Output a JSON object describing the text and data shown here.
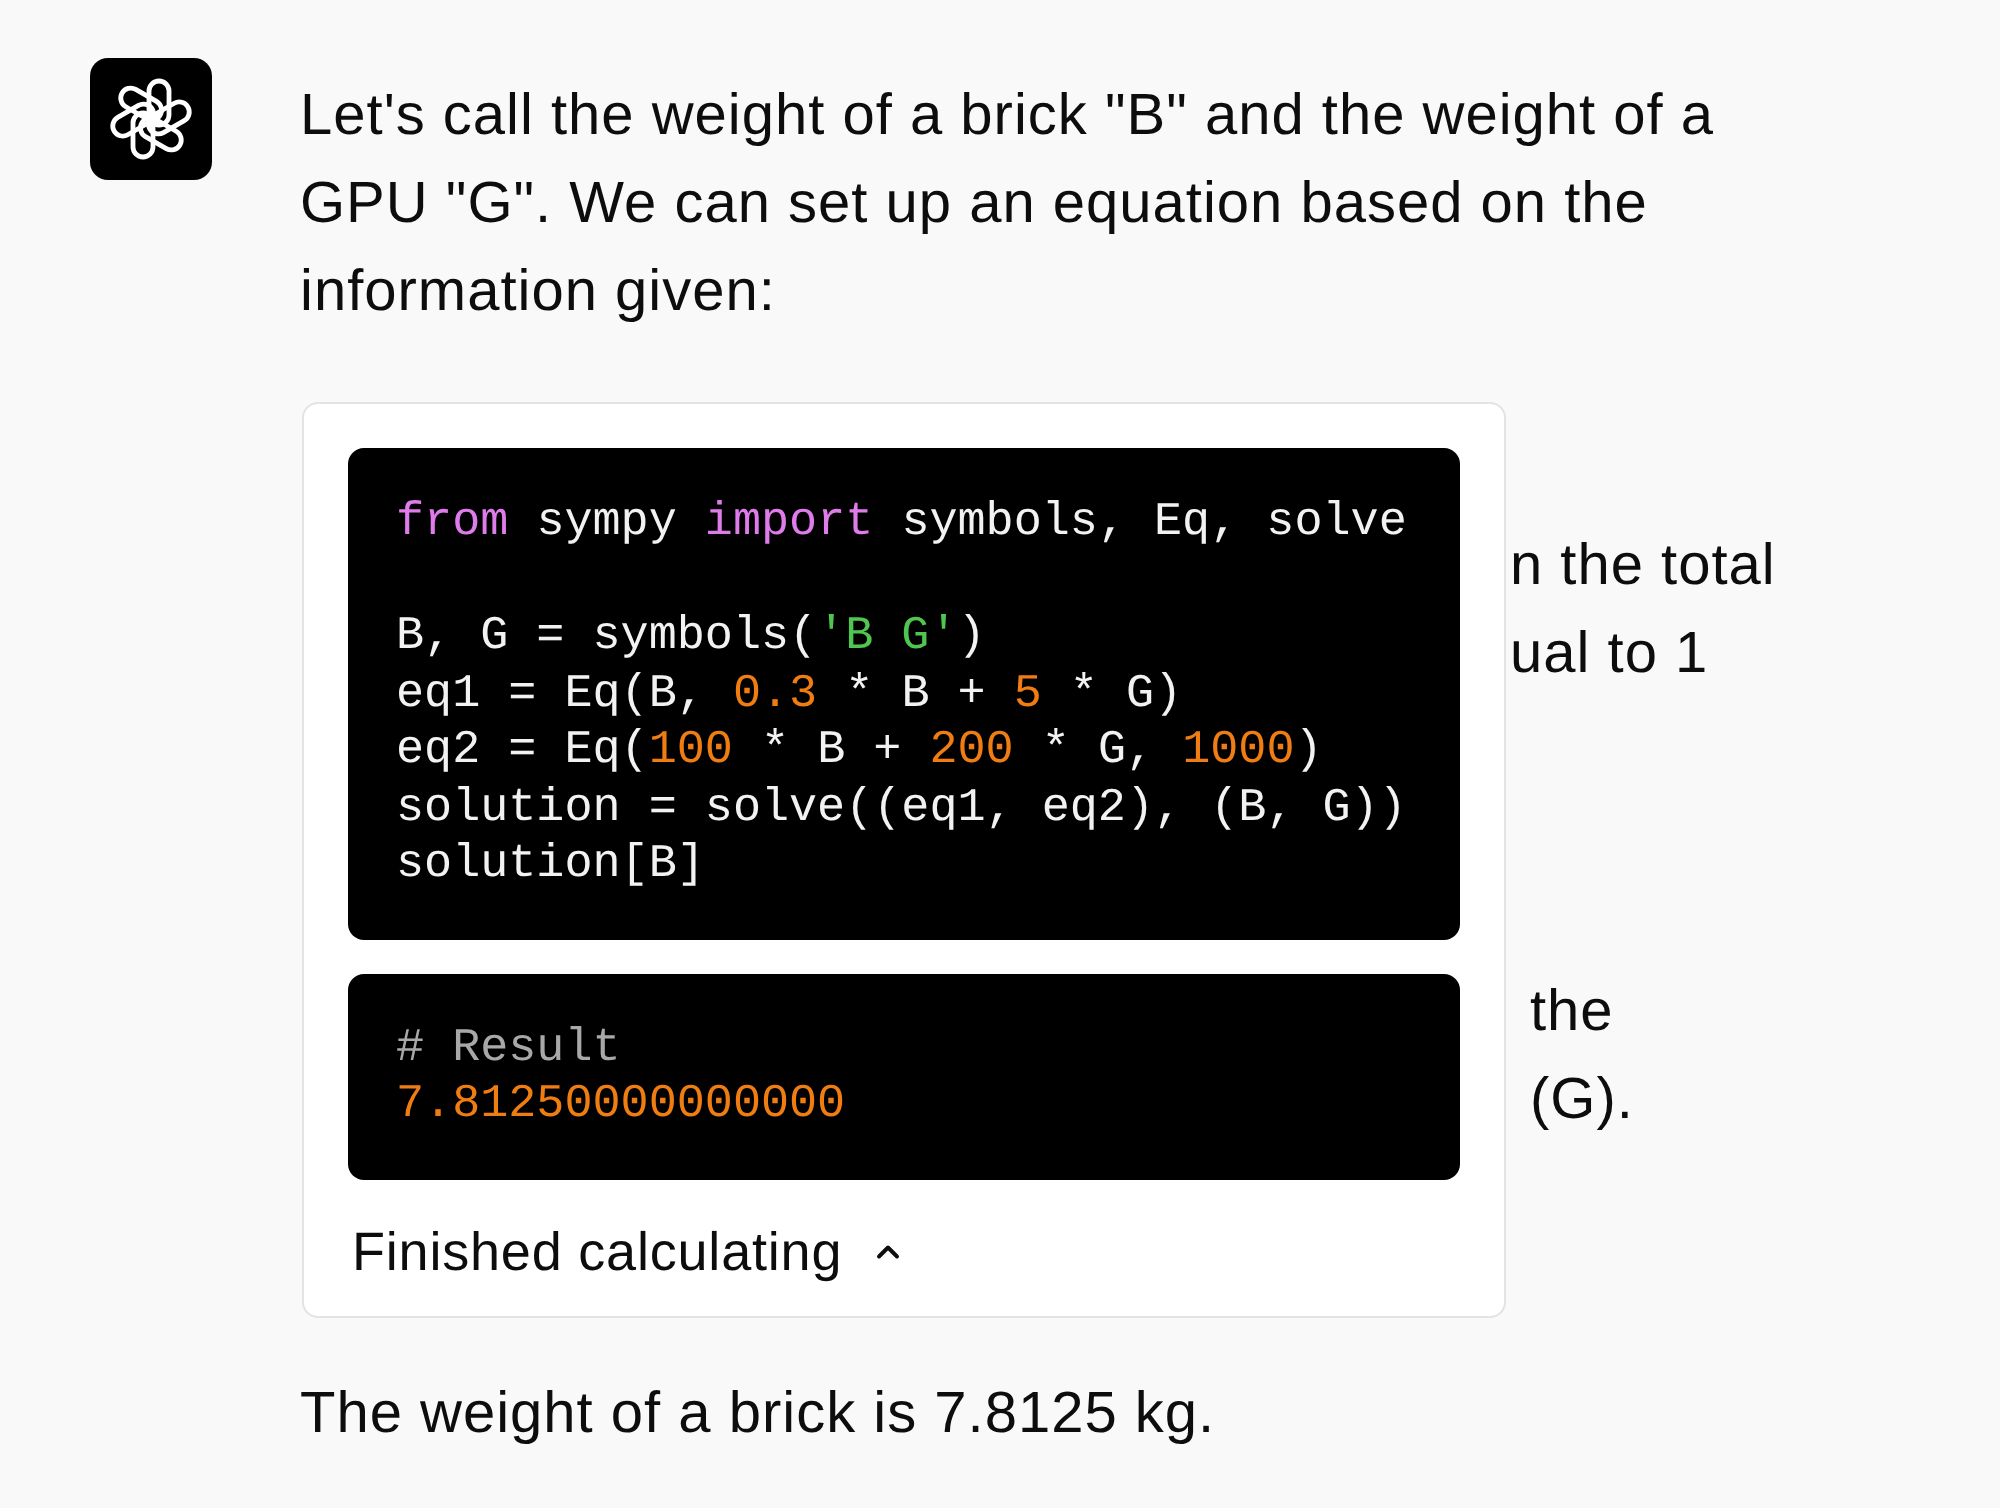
{
  "message": {
    "intro": "Let's call the weight of a brick \"B\" and the weight of a GPU \"G\". We can set up an equation based on the information given:",
    "covered_text": [
      [
        "n the total",
        "ual to 1"
      ],
      [
        "the",
        "(G)."
      ]
    ],
    "tool_card": {
      "code": {
        "blocks": [
          [
            [
              {
                "kind": "keyword",
                "text": "from"
              },
              {
                "kind": "plain",
                "text": " sympy "
              },
              {
                "kind": "keyword",
                "text": "import"
              },
              {
                "kind": "plain",
                "text": " symbols, Eq, solve"
              }
            ]
          ],
          [
            [
              {
                "kind": "plain",
                "text": "B, G = symbols("
              },
              {
                "kind": "string",
                "text": "'B G'"
              },
              {
                "kind": "plain",
                "text": ")"
              }
            ],
            [
              {
                "kind": "plain",
                "text": "eq1 = Eq(B, "
              },
              {
                "kind": "number",
                "text": "0.3"
              },
              {
                "kind": "plain",
                "text": " * B + "
              },
              {
                "kind": "number",
                "text": "5"
              },
              {
                "kind": "plain",
                "text": " * G)"
              }
            ],
            [
              {
                "kind": "plain",
                "text": "eq2 = Eq("
              },
              {
                "kind": "number",
                "text": "100"
              },
              {
                "kind": "plain",
                "text": " * B + "
              },
              {
                "kind": "number",
                "text": "200"
              },
              {
                "kind": "plain",
                "text": " * G, "
              },
              {
                "kind": "number",
                "text": "1000"
              },
              {
                "kind": "plain",
                "text": ")"
              }
            ],
            [
              {
                "kind": "plain",
                "text": "solution = solve((eq1, eq2), (B, G))"
              }
            ],
            [
              {
                "kind": "plain",
                "text": "solution[B]"
              }
            ]
          ]
        ]
      },
      "result": {
        "blocks": [
          [
            [
              {
                "kind": "comment",
                "text": "# Result"
              }
            ],
            [
              {
                "kind": "number",
                "text": "7.81250000000000"
              }
            ]
          ]
        ]
      },
      "status": {
        "label": "Finished calculating",
        "expanded": true
      }
    },
    "answer": "The weight of a brick is 7.8125 kg."
  }
}
